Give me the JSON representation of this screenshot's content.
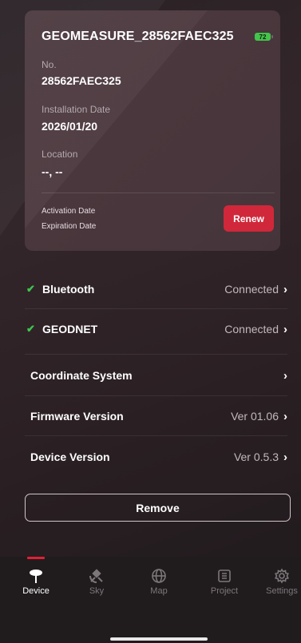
{
  "device_card": {
    "title": "GEOMEASURE_28562FAEC325",
    "battery": "72",
    "no_label": "No.",
    "no_value": "28562FAEC325",
    "install_label": "Installation Date",
    "install_value": "2026/01/20",
    "location_label": "Location",
    "location_value": "--, --",
    "activation_label": "Activation Date",
    "expiration_label": "Expiration Date",
    "renew_label": "Renew"
  },
  "rows": [
    {
      "name": "Bluetooth",
      "status": "Connected",
      "checked": true
    },
    {
      "name": "GEODNET",
      "status": "Connected",
      "checked": true
    },
    {
      "name": "Coordinate System",
      "status": "",
      "checked": false
    },
    {
      "name": "Firmware Version",
      "status": "Ver 01.06",
      "checked": false
    },
    {
      "name": "Device Version",
      "status": "Ver 0.5.3",
      "checked": false
    }
  ],
  "remove_label": "Remove",
  "tabs": [
    {
      "label": "Device",
      "icon": "device-icon",
      "active": true
    },
    {
      "label": "Sky",
      "icon": "satellite-icon",
      "active": false
    },
    {
      "label": "Map",
      "icon": "globe-icon",
      "active": false
    },
    {
      "label": "Project",
      "icon": "project-icon",
      "active": false
    },
    {
      "label": "Settings",
      "icon": "gear-icon",
      "active": false
    }
  ],
  "colors": {
    "accent": "#d0283a",
    "check": "#3fc44f",
    "battery": "#43c44b"
  }
}
